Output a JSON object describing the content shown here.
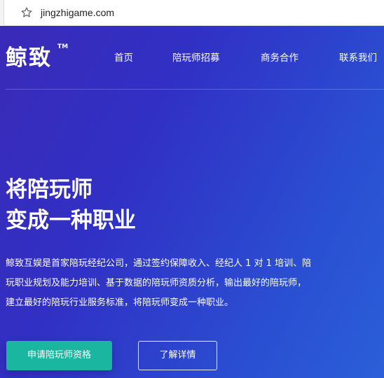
{
  "browser": {
    "url": "jingzhigame.com",
    "star_icon": "bookmark-star-icon"
  },
  "header": {
    "logo": "鲸致",
    "logo_tm": "TM",
    "nav": [
      "首页",
      "陪玩师招募",
      "商务合作",
      "联系我们"
    ]
  },
  "hero": {
    "headline": [
      "将陪玩师",
      "变成一种职业"
    ],
    "description": [
      "鲸致互娱是首家陪玩经纪公司，通过签约保障收入、经纪人 1 对 1 培训、陪",
      "玩职业规划及能力培训、基于数据的陪玩师资质分析，输出最好的陪玩师，",
      "建立最好的陪玩行业服务标准，将陪玩师变成一种职业。"
    ],
    "primary_button": "申请陪玩师资格",
    "secondary_button": "了解详情"
  },
  "colors": {
    "gradient_start": "#3a2ab8",
    "gradient_end": "#2b5fd8",
    "primary_button": "#1bb6a0"
  }
}
